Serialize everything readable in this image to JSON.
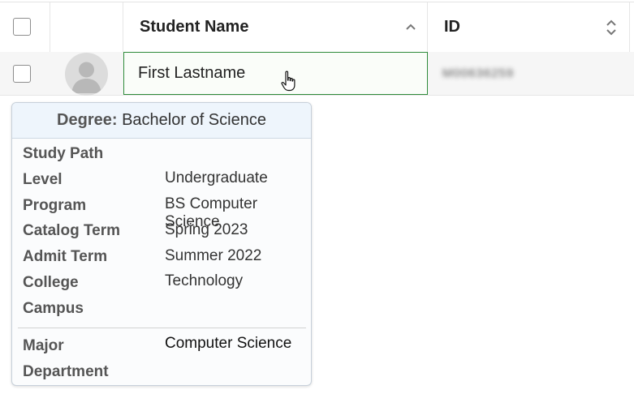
{
  "table": {
    "header": {
      "student_name_label": "Student Name",
      "id_label": "ID"
    },
    "rows": [
      {
        "name": "First Lastname",
        "id_blurred": "M00636259"
      }
    ]
  },
  "popover": {
    "title_key": "Degree:",
    "title_value": "Bachelor of Science",
    "fields": [
      {
        "label": "Study Path",
        "value": ""
      },
      {
        "label": "Level",
        "value": "Undergraduate"
      },
      {
        "label": "Program",
        "value": "BS Computer Science"
      },
      {
        "label": "Catalog Term",
        "value": "Spring 2023"
      },
      {
        "label": "Admit Term",
        "value": "Summer 2022"
      },
      {
        "label": "College",
        "value": "Technology"
      },
      {
        "label": "Campus",
        "value": ""
      }
    ],
    "major_fields": [
      {
        "label": "Major",
        "value": "Computer Science"
      },
      {
        "label": "Department",
        "value": ""
      }
    ]
  },
  "colors": {
    "active_border": "#2e8b3a",
    "popover_header_bg": "#eef5fc"
  },
  "icons": {
    "sort_ascending": "chevron-up-icon",
    "sort_both": "sort-updown-icon",
    "avatar": "user-avatar-icon",
    "cursor": "hand-pointer-icon"
  }
}
